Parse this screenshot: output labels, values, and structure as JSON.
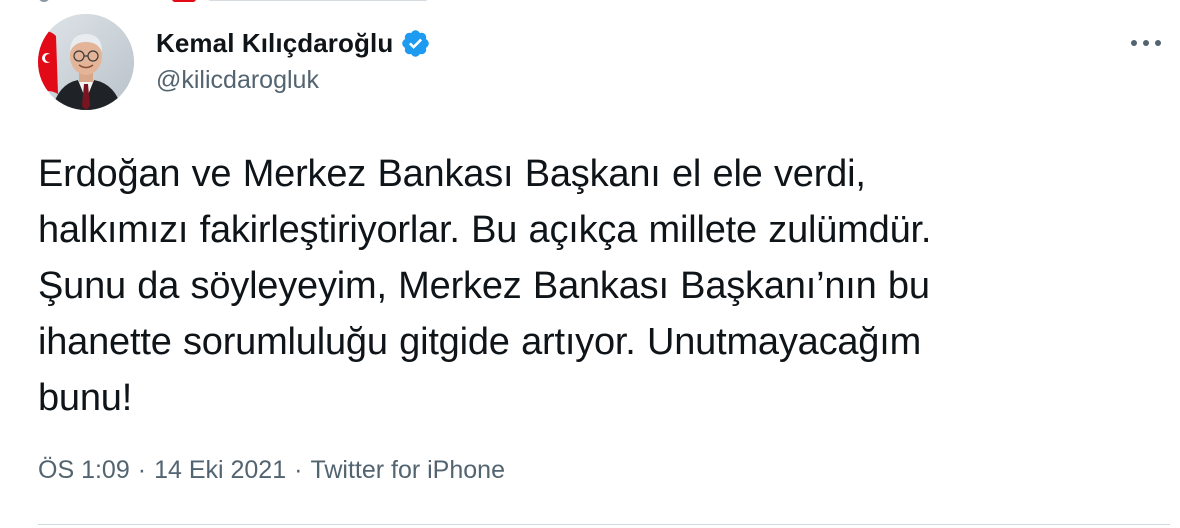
{
  "author": {
    "display_name": "Kemal Kılıçdaroğlu",
    "handle": "@kilicdarogluk",
    "verified": true
  },
  "icons": {
    "verified": "verified-badge-icon",
    "more": "more-options-icon"
  },
  "colors": {
    "verified_blue": "#1d9bf0",
    "text_primary": "#0f1419",
    "text_secondary": "#536471",
    "flag_red": "#e30a17"
  },
  "tweet": {
    "lines": [
      "Erdoğan ve Merkez Bankası Başkanı el ele verdi,",
      "halkımızı fakirleştiriyorlar. Bu açıkça millete zulümdür.",
      "Şunu da söyleyeyim, Merkez Bankası Başkanı’nın bu",
      "ihanette sorumluluğu gitgide artıyor. Unutmayacağım",
      "bunu!"
    ]
  },
  "meta": {
    "time": "ÖS 1:09",
    "separator": "·",
    "date": "14 Eki 2021",
    "source": "Twitter for iPhone"
  }
}
